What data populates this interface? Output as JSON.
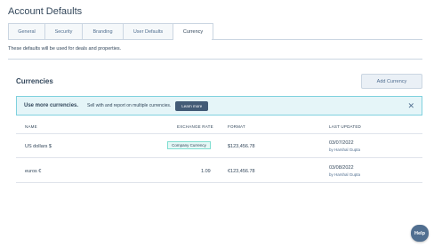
{
  "page": {
    "title": "Account Defaults"
  },
  "tabs": [
    {
      "label": "General"
    },
    {
      "label": "Security"
    },
    {
      "label": "Branding"
    },
    {
      "label": "User Defaults"
    },
    {
      "label": "Currency",
      "active": true
    }
  ],
  "description": "These defaults will be used for deals and properties.",
  "currencies": {
    "title": "Currencies",
    "add_button": "Add Currency",
    "banner": {
      "strong": "Use more currencies.",
      "text": "Sell with and report on multiple currencies.",
      "button": "Learn more",
      "close": "✕"
    },
    "columns": {
      "name": "NAME",
      "rate": "EXCHANGE RATE",
      "format": "FORMAT",
      "updated": "LAST UPDATED"
    },
    "rows": [
      {
        "name": "US dollars $",
        "badge": "Company Currency",
        "rate": "",
        "format": "$123,456.78",
        "date": "03/07/2022",
        "by": "by Harshal Gupta"
      },
      {
        "name": "euros €",
        "badge": "",
        "rate": "1.09",
        "format": "€123,456.78",
        "date": "03/08/2022",
        "by": "by Harshal Gupta"
      }
    ]
  },
  "help": {
    "label": "Help"
  }
}
